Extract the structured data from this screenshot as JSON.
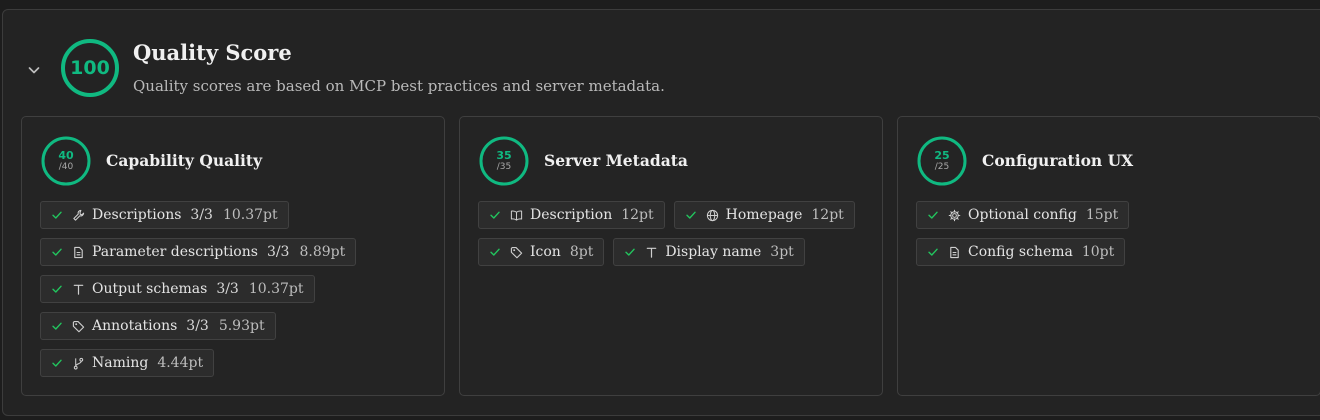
{
  "header": {
    "score": "100",
    "score_fraction": 1.0,
    "title": "Quality Score",
    "subtitle": "Quality scores are based on MCP best practices and server metadata."
  },
  "colors": {
    "accent": "#10b981",
    "check": "#22c55e"
  },
  "cards": [
    {
      "score": "40",
      "denom": "/40",
      "fraction": 1.0,
      "title": "Capability Quality",
      "rows": [
        [
          {
            "icon": "wrench-icon",
            "label": "Descriptions",
            "count": "3/3",
            "points": "10.37pt"
          }
        ],
        [
          {
            "icon": "document-icon",
            "label": "Parameter descriptions",
            "count": "3/3",
            "points": "8.89pt"
          }
        ],
        [
          {
            "icon": "text-icon",
            "label": "Output schemas",
            "count": "3/3",
            "points": "10.37pt"
          }
        ],
        [
          {
            "icon": "tag-icon",
            "label": "Annotations",
            "count": "3/3",
            "points": "5.93pt"
          }
        ],
        [
          {
            "icon": "git-branch-icon",
            "label": "Naming",
            "count": "",
            "points": "4.44pt"
          }
        ]
      ]
    },
    {
      "score": "35",
      "denom": "/35",
      "fraction": 1.0,
      "title": "Server Metadata",
      "rows": [
        [
          {
            "icon": "book-icon",
            "label": "Description",
            "count": "",
            "points": "12pt"
          },
          {
            "icon": "globe-icon",
            "label": "Homepage",
            "count": "",
            "points": "12pt"
          }
        ],
        [
          {
            "icon": "tag-icon",
            "label": "Icon",
            "count": "",
            "points": "8pt"
          },
          {
            "icon": "text-icon",
            "label": "Display name",
            "count": "",
            "points": "3pt"
          }
        ]
      ]
    },
    {
      "score": "25",
      "denom": "/25",
      "fraction": 1.0,
      "title": "Configuration UX",
      "rows": [
        [
          {
            "icon": "gear-icon",
            "label": "Optional config",
            "count": "",
            "points": "15pt"
          }
        ],
        [
          {
            "icon": "document-icon",
            "label": "Config schema",
            "count": "",
            "points": "10pt"
          }
        ]
      ]
    }
  ]
}
